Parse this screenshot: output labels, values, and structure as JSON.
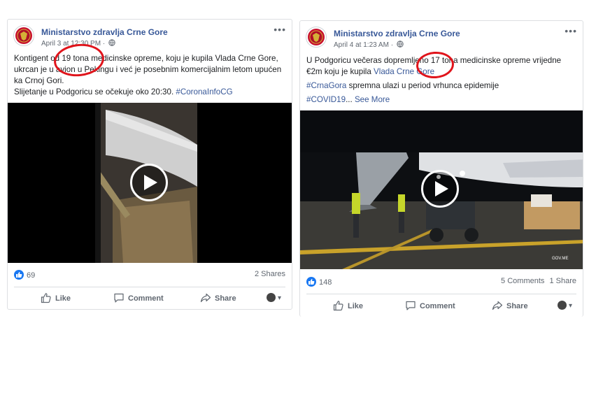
{
  "posts": [
    {
      "page_name": "Ministarstvo zdravlja Crne Gore",
      "timestamp": "April 3 at 12:30 PM",
      "text": {
        "line1": "Kontigent od 19 tona medicinske opreme, koju je kupila Vlada Crne Gore, ukrcan je u avion u Pekingu i već je posebnim komercijalnim letom upućen ka Crnoj Gori.",
        "line2_prefix": "Slijetanje u Podgoricu se očekuje oko 20:30. ",
        "hashtag": "#CoronaInfoCG"
      },
      "reactions": "69",
      "shares": "2 Shares",
      "actions": {
        "like": "Like",
        "comment": "Comment",
        "share": "Share"
      }
    },
    {
      "page_name": "Ministarstvo zdravlja Crne Gore",
      "timestamp": "April 4 at 1:23 AM",
      "text": {
        "line1_prefix": "U Podgoricu večeras dopremljeno 17 tona medicinske opreme vrijedne €2m koju je kupila ",
        "line1_link": "Vlada Crne Gore",
        "hashtag1": "#CrnaGora",
        "line2_rest": " spremna ulazi u period vrhunca epidemije",
        "hashtag2": "#COVID19",
        "ellipsis": "... ",
        "see_more": "See More"
      },
      "video_watermark": "GOV.ME",
      "reactions": "148",
      "comments": "5 Comments",
      "shares": "1 Share",
      "actions": {
        "like": "Like",
        "comment": "Comment",
        "share": "Share"
      }
    }
  ],
  "colors": {
    "link": "#385898",
    "annotation": "#e0141b",
    "like_badge": "#1877f2"
  },
  "icons": [
    "more-icon",
    "globe-icon",
    "play-icon",
    "like-reaction-icon",
    "like-icon",
    "comment-icon",
    "share-icon",
    "audience-icon",
    "chevron-down-icon"
  ]
}
